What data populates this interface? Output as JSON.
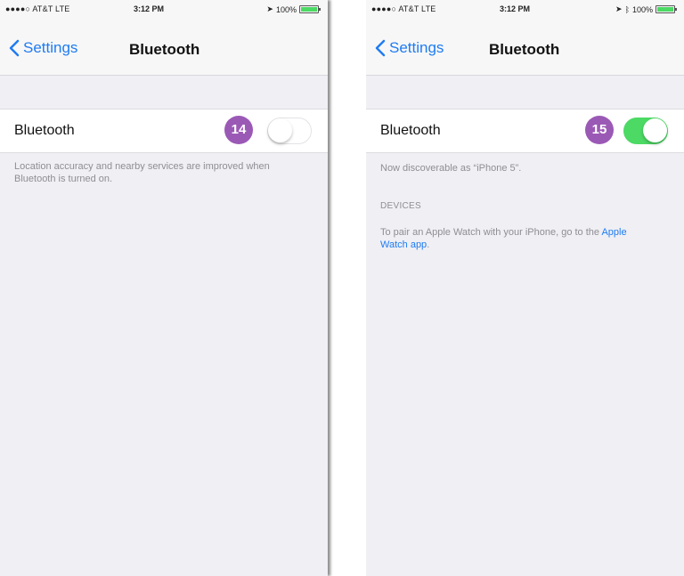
{
  "colors": {
    "accent": "#1f7cf2",
    "toggle_on": "#4cd964",
    "badge": "#9b59b6",
    "background": "#efeff4"
  },
  "left": {
    "status": {
      "carrier": "●●●●○ AT&T  LTE",
      "time": "3:12 PM",
      "battery": "100%",
      "battery_level": 1.0
    },
    "nav": {
      "back_label": "Settings",
      "title": "Bluetooth"
    },
    "cell": {
      "label": "Bluetooth",
      "toggle_state": "off"
    },
    "badge": "14",
    "footer": "Location accuracy and nearby services are improved when Bluetooth is turned on."
  },
  "right": {
    "status": {
      "carrier": "●●●●○ AT&T  LTE",
      "time": "3:12 PM",
      "battery": "100%",
      "battery_level": 1.0
    },
    "nav": {
      "back_label": "Settings",
      "title": "Bluetooth"
    },
    "cell": {
      "label": "Bluetooth",
      "toggle_state": "on"
    },
    "badge": "15",
    "discoverable": "Now discoverable as “iPhone 5”.",
    "devices_header": "DEVICES",
    "pair_text": "To pair an Apple Watch with your iPhone, go to the ",
    "pair_link": "Apple Watch app",
    "pair_end": "."
  }
}
